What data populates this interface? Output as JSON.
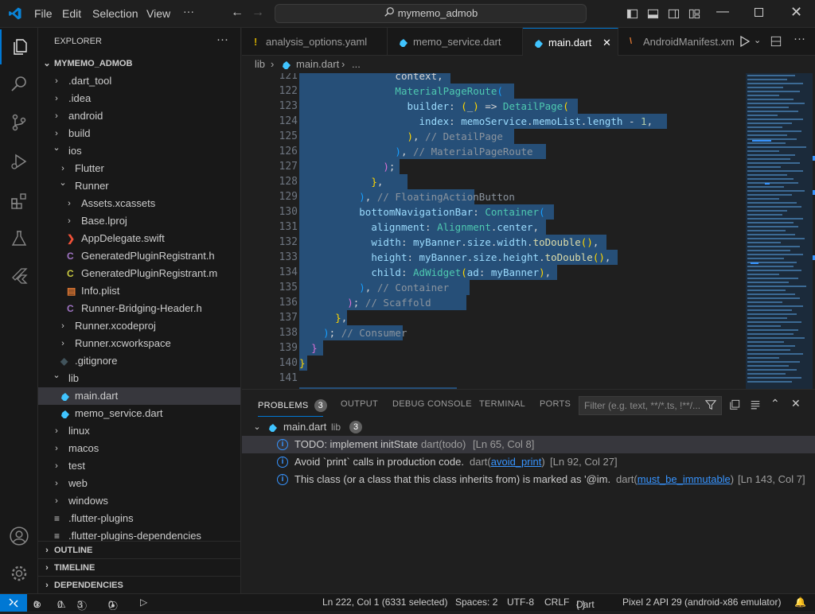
{
  "titlebar": {
    "menus": [
      "File",
      "Edit",
      "Selection",
      "View",
      "···"
    ],
    "search_text": "mymemo_admob"
  },
  "explorer": {
    "header": "EXPLORER",
    "project": "MYMEMO_ADMOB",
    "items": [
      {
        "label": ".dart_tool",
        "type": "folder",
        "open": false,
        "depth": 1
      },
      {
        "label": ".idea",
        "type": "folder",
        "open": false,
        "depth": 1
      },
      {
        "label": "android",
        "type": "folder",
        "open": false,
        "depth": 1
      },
      {
        "label": "build",
        "type": "folder",
        "open": false,
        "depth": 1
      },
      {
        "label": "ios",
        "type": "folder",
        "open": true,
        "depth": 1
      },
      {
        "label": "Flutter",
        "type": "folder",
        "open": false,
        "depth": 2
      },
      {
        "label": "Runner",
        "type": "folder",
        "open": true,
        "depth": 2
      },
      {
        "label": "Assets.xcassets",
        "type": "folder",
        "open": false,
        "depth": 3
      },
      {
        "label": "Base.lproj",
        "type": "folder",
        "open": false,
        "depth": 3
      },
      {
        "label": "AppDelegate.swift",
        "type": "swift",
        "depth": 3
      },
      {
        "label": "GeneratedPluginRegistrant.h",
        "type": "c",
        "depth": 3
      },
      {
        "label": "GeneratedPluginRegistrant.m",
        "type": "c-yellow",
        "depth": 3
      },
      {
        "label": "Info.plist",
        "type": "plist",
        "depth": 3
      },
      {
        "label": "Runner-Bridging-Header.h",
        "type": "c",
        "depth": 3
      },
      {
        "label": "Runner.xcodeproj",
        "type": "folder",
        "open": false,
        "depth": 2
      },
      {
        "label": "Runner.xcworkspace",
        "type": "folder",
        "open": false,
        "depth": 2
      },
      {
        "label": ".gitignore",
        "type": "git",
        "depth": 2
      },
      {
        "label": "lib",
        "type": "folder",
        "open": true,
        "depth": 1
      },
      {
        "label": "main.dart",
        "type": "dart",
        "depth": 2,
        "selected": true
      },
      {
        "label": "memo_service.dart",
        "type": "dart",
        "depth": 2
      },
      {
        "label": "linux",
        "type": "folder",
        "open": false,
        "depth": 1
      },
      {
        "label": "macos",
        "type": "folder",
        "open": false,
        "depth": 1
      },
      {
        "label": "test",
        "type": "folder",
        "open": false,
        "depth": 1
      },
      {
        "label": "web",
        "type": "folder",
        "open": false,
        "depth": 1
      },
      {
        "label": "windows",
        "type": "folder",
        "open": false,
        "depth": 1
      },
      {
        "label": ".flutter-plugins",
        "type": "list",
        "depth": 1
      },
      {
        "label": ".flutter-plugins-dependencies",
        "type": "list",
        "depth": 1
      }
    ],
    "sections": [
      "OUTLINE",
      "TIMELINE",
      "DEPENDENCIES"
    ]
  },
  "tabs": [
    {
      "label": "analysis_options.yaml",
      "icon": "yaml-icon",
      "active": false
    },
    {
      "label": "memo_service.dart",
      "icon": "dart-icon",
      "active": false
    },
    {
      "label": "main.dart",
      "icon": "dart-icon",
      "active": true
    },
    {
      "label": "AndroidManifest.xml",
      "icon": "xml-icon",
      "active": false
    }
  ],
  "breadcrumb": {
    "folder": "lib",
    "file": "main.dart",
    "more": "..."
  },
  "editor": {
    "lines": [
      {
        "n": "121",
        "html": "                <span class='w'>context,</span>"
      },
      {
        "n": "122",
        "html": "                <span class='t'>MaterialPageRoute</span><span class='p3'>(</span>"
      },
      {
        "n": "123",
        "html": "                  <span class='k'>builder</span><span class='w'>: </span><span class='p1'>(</span><span class='w'>_</span><span class='p1'>)</span><span class='w'> => </span><span class='t'>DetailPage</span><span class='p1'>(</span>"
      },
      {
        "n": "124",
        "html": "                    <span class='k'>index</span><span class='w'>: </span><span class='k'>memoService</span><span class='w'>.</span><span class='k'>memoList</span><span class='w'>.</span><span class='k'>length</span><span class='w'> - </span><span class='n'>1</span><span class='w'>,</span>"
      },
      {
        "n": "125",
        "html": "                  <span class='p1'>)</span><span class='w'>, </span><span class='cm'>// DetailPage</span>"
      },
      {
        "n": "126",
        "html": "                <span class='p3'>)</span><span class='w'>, </span><span class='cm'>// MaterialPageRoute</span>"
      },
      {
        "n": "127",
        "html": "              <span class='p2'>)</span><span class='w'>;</span>"
      },
      {
        "n": "128",
        "html": "            <span class='p1'>}</span><span class='w'>,</span>"
      },
      {
        "n": "129",
        "html": "          <span class='p3'>)</span><span class='w'>, </span><span class='cm'>// FloatingActionButton</span>"
      },
      {
        "n": "130",
        "html": "          <span class='k'>bottomNavigationBar</span><span class='w'>: </span><span class='t'>Container</span><span class='p3'>(</span>"
      },
      {
        "n": "131",
        "html": "            <span class='k'>alignment</span><span class='w'>: </span><span class='t'>Alignment</span><span class='w'>.</span><span class='k'>center</span><span class='w'>,</span>"
      },
      {
        "n": "132",
        "html": "            <span class='k'>width</span><span class='w'>: </span><span class='k'>myBanner</span><span class='w'>.</span><span class='k'>size</span><span class='w'>.</span><span class='k'>width</span><span class='w'>.</span><span class='f'>toDouble</span><span class='p1'>()</span><span class='w'>,</span>"
      },
      {
        "n": "133",
        "html": "            <span class='k'>height</span><span class='w'>: </span><span class='k'>myBanner</span><span class='w'>.</span><span class='k'>size</span><span class='w'>.</span><span class='k'>height</span><span class='w'>.</span><span class='f'>toDouble</span><span class='p1'>()</span><span class='w'>,</span>"
      },
      {
        "n": "134",
        "html": "            <span class='k'>child</span><span class='w'>: </span><span class='t'>AdWidget</span><span class='p1'>(</span><span class='k'>ad</span><span class='w'>: </span><span class='k'>myBanner</span><span class='p1'>)</span><span class='w'>,</span>"
      },
      {
        "n": "135",
        "html": "          <span class='p3'>)</span><span class='w'>, </span><span class='cm'>// Container</span>"
      },
      {
        "n": "136",
        "html": "        <span class='p2'>)</span><span class='w'>; </span><span class='cm'>// Scaffold</span>"
      },
      {
        "n": "137",
        "html": "      <span class='p1'>}</span><span class='w'>,</span>"
      },
      {
        "n": "138",
        "html": "    <span class='p3'>)</span><span class='w'>; </span><span class='cm'>// Consumer</span>"
      },
      {
        "n": "139",
        "html": "  <span class='p2'>}</span>"
      },
      {
        "n": "140",
        "html": "<span class='p1'>}</span>"
      },
      {
        "n": "141",
        "html": ""
      }
    ]
  },
  "panel": {
    "tabs": [
      "PROBLEMS",
      "OUTPUT",
      "DEBUG CONSOLE",
      "TERMINAL",
      "PORTS"
    ],
    "problems_count": "3",
    "filter_placeholder": "Filter (e.g. text, **/*.ts, !**/...",
    "group": {
      "file": "main.dart",
      "folder": "lib",
      "count": "3"
    },
    "problems": [
      {
        "message": "TODO: implement initState",
        "source": "dart(todo)",
        "source_prefix": "",
        "link": "",
        "location": "[Ln 65, Col 8]"
      },
      {
        "message": "Avoid `print` calls in production code.",
        "source_prefix": "dart(",
        "link": "avoid_print",
        "source_suffix": ")",
        "location": "[Ln 92, Col 27]"
      },
      {
        "message": "This class (or a class that this class inherits from) is marked as '@im...",
        "source_prefix": "dart(",
        "link": "must_be_immutable",
        "source_suffix": ")",
        "location": "[Ln 143, Col 7]"
      }
    ]
  },
  "statusbar": {
    "errors": "0",
    "warnings": "0",
    "infos": "3",
    "ports": "0",
    "cursor": "Ln 222, Col 1 (6331 selected)",
    "spaces": "Spaces: 2",
    "encoding": "UTF-8",
    "eol": "CRLF",
    "language": "Dart",
    "device": "Pixel 2 API 29 (android-x86 emulator)"
  },
  "colors": {
    "accent": "#0078d4",
    "selection": "#264f78",
    "dart": "#40c4ff"
  }
}
